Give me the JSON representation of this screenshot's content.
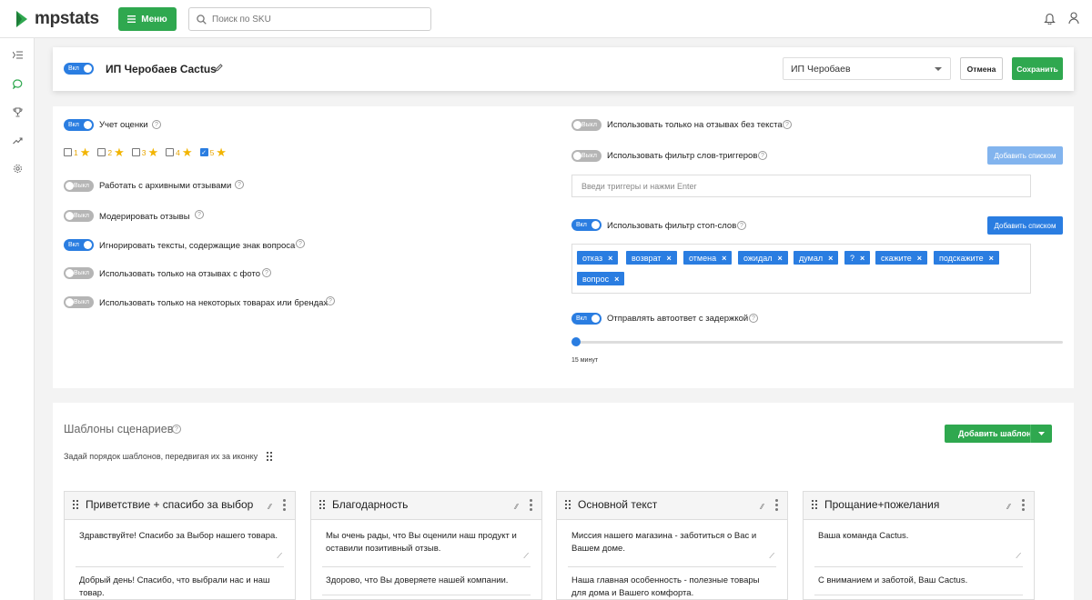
{
  "header": {
    "logo_text": "mpstats",
    "menu_label": "Меню",
    "search_placeholder": "Поиск по SKU"
  },
  "store": {
    "toggle_label": "Вкл",
    "title": "ИП Черобаев Cactus",
    "select_value": "ИП Черобаев",
    "cancel_label": "Отмена",
    "save_label": "Сохранить"
  },
  "settings_left": {
    "rating_toggle": "Вкл",
    "rating_label": "Учет оценки",
    "ratings": [
      {
        "value": "1",
        "checked": false
      },
      {
        "value": "2",
        "checked": false
      },
      {
        "value": "3",
        "checked": false
      },
      {
        "value": "4",
        "checked": false
      },
      {
        "value": "5",
        "checked": true
      }
    ],
    "archive": {
      "toggle": "Выкл",
      "label": "Работать с архивными отзывами"
    },
    "moderate": {
      "toggle": "Выкл",
      "label": "Модерировать отзывы"
    },
    "ignore_q": {
      "toggle": "Вкл",
      "label": "Игнорировать тексты, содержащие знак вопроса"
    },
    "photo_only": {
      "toggle": "Выкл",
      "label": "Использовать только на отзывах с фото"
    },
    "some_goods": {
      "toggle": "Выкл",
      "label": "Использовать только на некоторых товарах или брендах"
    }
  },
  "settings_right": {
    "no_text": {
      "toggle": "Выкл",
      "label": "Использовать только на отзывах без текста"
    },
    "triggers": {
      "toggle": "Выкл",
      "label": "Использовать фильтр слов-триггеров",
      "button": "Добавить списком",
      "placeholder": "Введи триггеры и нажми Enter"
    },
    "stopwords": {
      "toggle": "Вкл",
      "label": "Использовать фильтр стоп-слов",
      "button": "Добавить списком"
    },
    "tags": [
      "отказ",
      "возврат",
      "отмена",
      "ожидал",
      "думал",
      "?",
      "скажите",
      "подскажите",
      "вопрос"
    ],
    "delay": {
      "toggle": "Вкл",
      "label": "Отправлять автоответ с задержкой",
      "value": "15 минут",
      "fraction": 0
    }
  },
  "templates": {
    "title": "Шаблоны сценариев",
    "subtitle": "Задай порядок шаблонов, передвигая их за иконку",
    "add_button": "Добавить шаблон",
    "cards": [
      {
        "title": "Приветствие + спасибо за выбор",
        "msg1": "Здравствуйте! Спасибо за Выбор нашего товара.",
        "msg2": "Добрый день! Спасибо, что выбрали нас и наш товар."
      },
      {
        "title": "Благодарность",
        "msg1": "Мы очень рады, что Вы оценили наш продукт и оставили позитивный отзыв.",
        "msg2": "Здорово, что Вы доверяете нашей компании."
      },
      {
        "title": "Основной текст",
        "msg1": "Миссия нашего магазина - заботиться о Вас и Вашем доме.",
        "msg2": "Наша главная особенность - полезные товары для дома и Вашего комфорта."
      },
      {
        "title": "Прощание+пожелания",
        "msg1": "Ваша команда Cactus.",
        "msg2": "С вниманием и заботой, Ваш Cactus."
      }
    ]
  },
  "colors": {
    "brand_green": "#2fa84f",
    "accent_blue": "#2a7de1",
    "disabled_blue": "#82b4ee"
  }
}
